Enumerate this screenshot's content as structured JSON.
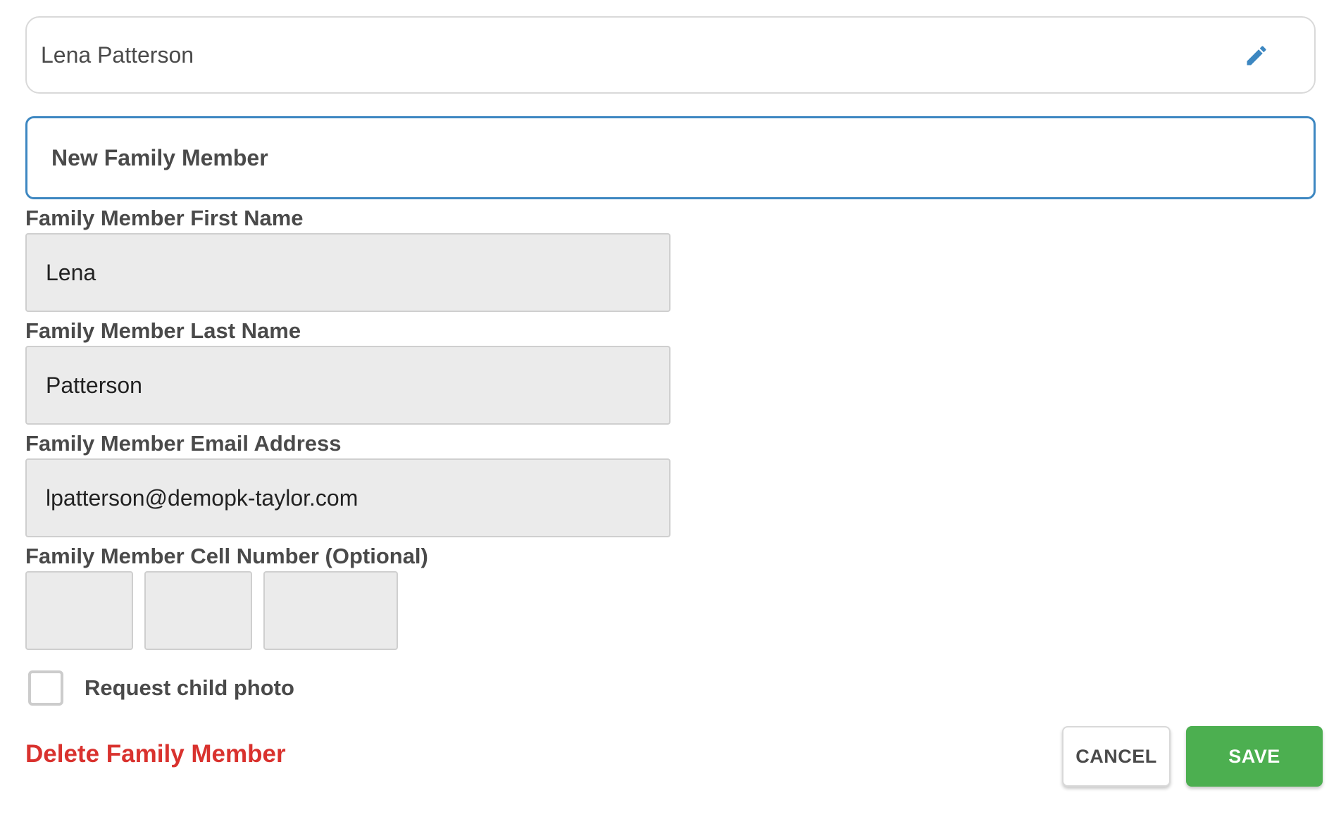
{
  "header": {
    "member_name": "Lena Patterson",
    "edit_icon": "pencil-icon"
  },
  "section": {
    "title": "New Family Member"
  },
  "form": {
    "first_name": {
      "label": "Family Member First Name",
      "value": "Lena"
    },
    "last_name": {
      "label": "Family Member Last Name",
      "value": "Patterson"
    },
    "email": {
      "label": "Family Member Email Address",
      "value": "lpatterson@demopk-taylor.com"
    },
    "cell": {
      "label": "Family Member Cell Number (Optional)",
      "area_code": "",
      "prefix": "",
      "line": ""
    },
    "request_photo": {
      "label": "Request child photo",
      "checked": false
    }
  },
  "actions": {
    "delete_label": "Delete Family Member",
    "cancel_label": "CANCEL",
    "save_label": "SAVE"
  },
  "colors": {
    "accent_blue": "#3d87c1",
    "delete_red": "#d9322e",
    "save_green": "#4caf50",
    "input_bg": "#ebebeb",
    "text": "#4a4a4a"
  }
}
